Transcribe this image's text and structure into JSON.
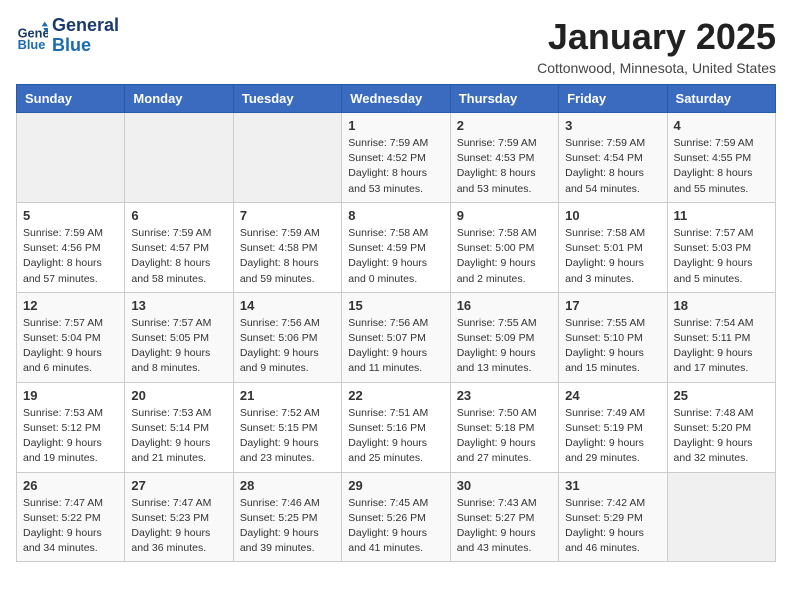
{
  "header": {
    "logo_line1": "General",
    "logo_line2": "Blue",
    "month": "January 2025",
    "location": "Cottonwood, Minnesota, United States"
  },
  "weekdays": [
    "Sunday",
    "Monday",
    "Tuesday",
    "Wednesday",
    "Thursday",
    "Friday",
    "Saturday"
  ],
  "weeks": [
    [
      {
        "day": "",
        "info": ""
      },
      {
        "day": "",
        "info": ""
      },
      {
        "day": "",
        "info": ""
      },
      {
        "day": "1",
        "info": "Sunrise: 7:59 AM\nSunset: 4:52 PM\nDaylight: 8 hours and 53 minutes."
      },
      {
        "day": "2",
        "info": "Sunrise: 7:59 AM\nSunset: 4:53 PM\nDaylight: 8 hours and 53 minutes."
      },
      {
        "day": "3",
        "info": "Sunrise: 7:59 AM\nSunset: 4:54 PM\nDaylight: 8 hours and 54 minutes."
      },
      {
        "day": "4",
        "info": "Sunrise: 7:59 AM\nSunset: 4:55 PM\nDaylight: 8 hours and 55 minutes."
      }
    ],
    [
      {
        "day": "5",
        "info": "Sunrise: 7:59 AM\nSunset: 4:56 PM\nDaylight: 8 hours and 57 minutes."
      },
      {
        "day": "6",
        "info": "Sunrise: 7:59 AM\nSunset: 4:57 PM\nDaylight: 8 hours and 58 minutes."
      },
      {
        "day": "7",
        "info": "Sunrise: 7:59 AM\nSunset: 4:58 PM\nDaylight: 8 hours and 59 minutes."
      },
      {
        "day": "8",
        "info": "Sunrise: 7:58 AM\nSunset: 4:59 PM\nDaylight: 9 hours and 0 minutes."
      },
      {
        "day": "9",
        "info": "Sunrise: 7:58 AM\nSunset: 5:00 PM\nDaylight: 9 hours and 2 minutes."
      },
      {
        "day": "10",
        "info": "Sunrise: 7:58 AM\nSunset: 5:01 PM\nDaylight: 9 hours and 3 minutes."
      },
      {
        "day": "11",
        "info": "Sunrise: 7:57 AM\nSunset: 5:03 PM\nDaylight: 9 hours and 5 minutes."
      }
    ],
    [
      {
        "day": "12",
        "info": "Sunrise: 7:57 AM\nSunset: 5:04 PM\nDaylight: 9 hours and 6 minutes."
      },
      {
        "day": "13",
        "info": "Sunrise: 7:57 AM\nSunset: 5:05 PM\nDaylight: 9 hours and 8 minutes."
      },
      {
        "day": "14",
        "info": "Sunrise: 7:56 AM\nSunset: 5:06 PM\nDaylight: 9 hours and 9 minutes."
      },
      {
        "day": "15",
        "info": "Sunrise: 7:56 AM\nSunset: 5:07 PM\nDaylight: 9 hours and 11 minutes."
      },
      {
        "day": "16",
        "info": "Sunrise: 7:55 AM\nSunset: 5:09 PM\nDaylight: 9 hours and 13 minutes."
      },
      {
        "day": "17",
        "info": "Sunrise: 7:55 AM\nSunset: 5:10 PM\nDaylight: 9 hours and 15 minutes."
      },
      {
        "day": "18",
        "info": "Sunrise: 7:54 AM\nSunset: 5:11 PM\nDaylight: 9 hours and 17 minutes."
      }
    ],
    [
      {
        "day": "19",
        "info": "Sunrise: 7:53 AM\nSunset: 5:12 PM\nDaylight: 9 hours and 19 minutes."
      },
      {
        "day": "20",
        "info": "Sunrise: 7:53 AM\nSunset: 5:14 PM\nDaylight: 9 hours and 21 minutes."
      },
      {
        "day": "21",
        "info": "Sunrise: 7:52 AM\nSunset: 5:15 PM\nDaylight: 9 hours and 23 minutes."
      },
      {
        "day": "22",
        "info": "Sunrise: 7:51 AM\nSunset: 5:16 PM\nDaylight: 9 hours and 25 minutes."
      },
      {
        "day": "23",
        "info": "Sunrise: 7:50 AM\nSunset: 5:18 PM\nDaylight: 9 hours and 27 minutes."
      },
      {
        "day": "24",
        "info": "Sunrise: 7:49 AM\nSunset: 5:19 PM\nDaylight: 9 hours and 29 minutes."
      },
      {
        "day": "25",
        "info": "Sunrise: 7:48 AM\nSunset: 5:20 PM\nDaylight: 9 hours and 32 minutes."
      }
    ],
    [
      {
        "day": "26",
        "info": "Sunrise: 7:47 AM\nSunset: 5:22 PM\nDaylight: 9 hours and 34 minutes."
      },
      {
        "day": "27",
        "info": "Sunrise: 7:47 AM\nSunset: 5:23 PM\nDaylight: 9 hours and 36 minutes."
      },
      {
        "day": "28",
        "info": "Sunrise: 7:46 AM\nSunset: 5:25 PM\nDaylight: 9 hours and 39 minutes."
      },
      {
        "day": "29",
        "info": "Sunrise: 7:45 AM\nSunset: 5:26 PM\nDaylight: 9 hours and 41 minutes."
      },
      {
        "day": "30",
        "info": "Sunrise: 7:43 AM\nSunset: 5:27 PM\nDaylight: 9 hours and 43 minutes."
      },
      {
        "day": "31",
        "info": "Sunrise: 7:42 AM\nSunset: 5:29 PM\nDaylight: 9 hours and 46 minutes."
      },
      {
        "day": "",
        "info": ""
      }
    ]
  ]
}
